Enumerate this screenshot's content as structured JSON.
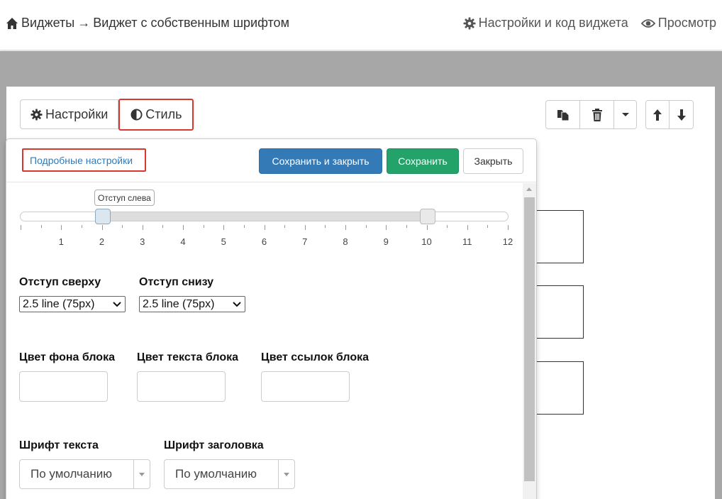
{
  "breadcrumb": {
    "widgets_label": "Виджеты",
    "arrow": "→",
    "current_label": "Виджет с собственным шрифтом"
  },
  "topnav": {
    "settings_code_label": "Настройки и код виджета",
    "preview_label": "Просмотр"
  },
  "tabs": [
    {
      "label": "Настройки",
      "icon": "gear-icon"
    },
    {
      "label": "Стиль",
      "icon": "contrast-icon",
      "active": true
    }
  ],
  "toolbar": {
    "icons": [
      "copy-icon",
      "trash-icon",
      "caret-down-icon",
      "arrow-up-icon",
      "arrow-down-icon"
    ]
  },
  "panel": {
    "advanced_link": "Подробные настройки",
    "save_close_label": "Сохранить и закрыть",
    "save_label": "Сохранить",
    "close_label": "Закрыть",
    "slider": {
      "tooltip": "Отступ слева",
      "ticks": [
        "1",
        "2",
        "3",
        "4",
        "5",
        "6",
        "7",
        "8",
        "9",
        "10",
        "11",
        "12"
      ],
      "low_value": 2,
      "high_value": 10
    },
    "margin_top": {
      "label": "Отступ сверху",
      "value": "2.5 line (75px)"
    },
    "margin_bottom": {
      "label": "Отступ снизу",
      "value": "2.5 line (75px)"
    },
    "bg_color": {
      "label": "Цвет фона блока",
      "value": ""
    },
    "text_color": {
      "label": "Цвет текста блока",
      "value": ""
    },
    "link_color": {
      "label": "Цвет ссылок блока",
      "value": ""
    },
    "text_font": {
      "label": "Шрифт текста",
      "value": "По умолчанию"
    },
    "heading_font": {
      "label": "Шрифт заголовка",
      "value": "По умолчанию"
    }
  },
  "colors": {
    "highlight": "#d9372f",
    "primary": "#337ab7",
    "success": "#23a269",
    "backdrop": "#a7a7a7"
  }
}
